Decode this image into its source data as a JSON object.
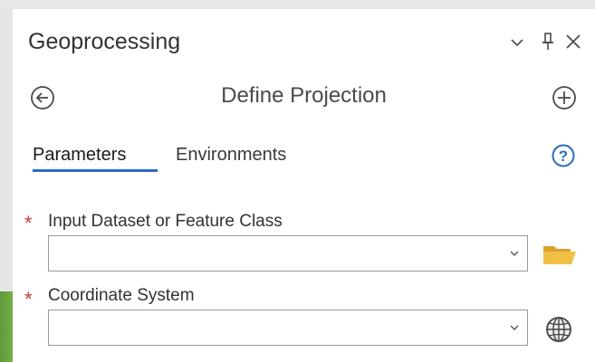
{
  "panel": {
    "title": "Geoprocessing",
    "tool_title": "Define Projection"
  },
  "tabs": [
    {
      "label": "Parameters",
      "active": true
    },
    {
      "label": "Environments",
      "active": false
    }
  ],
  "parameters": [
    {
      "required_marker": "*",
      "label": "Input Dataset or Feature Class",
      "value": "",
      "browse_icon": "folder-icon"
    },
    {
      "required_marker": "*",
      "label": "Coordinate System",
      "value": "",
      "browse_icon": "globe-icon"
    }
  ],
  "icons": {
    "options": "chevron-down-icon",
    "pin": "pin-icon",
    "close": "close-icon",
    "back": "back-arrow-icon",
    "add": "add-icon",
    "help": "help-icon"
  },
  "colors": {
    "accent": "#2a6dbd",
    "required": "#d0352b",
    "folder": "#e8b43a"
  }
}
